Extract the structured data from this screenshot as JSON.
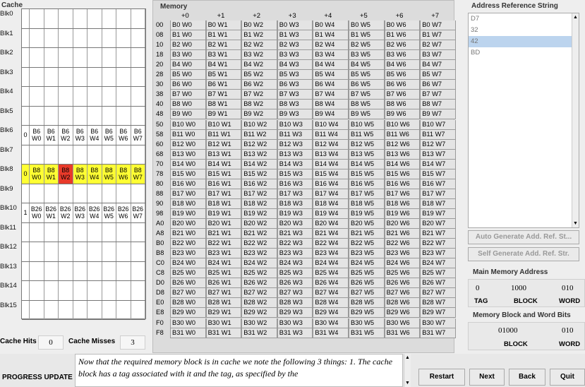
{
  "cache": {
    "title": "Cache",
    "hits_label": "Cache Hits",
    "hits": "0",
    "misses_label": "Cache Misses",
    "misses": "3",
    "blocks": [
      {
        "label": "Blk0"
      },
      {
        "label": "Blk1"
      },
      {
        "label": "Blk2"
      },
      {
        "label": "Blk3"
      },
      {
        "label": "Blk4"
      },
      {
        "label": "Blk5"
      },
      {
        "label": "Blk6",
        "tag": "0",
        "cells": [
          "B6 W0",
          "B6 W1",
          "B6 W2",
          "B6 W3",
          "B6 W4",
          "B6 W5",
          "B6 W6",
          "B6 W7"
        ]
      },
      {
        "label": "Blk7"
      },
      {
        "label": "Blk8",
        "tag": "0",
        "cells": [
          "B8 W0",
          "B8 W1",
          "B8 W2",
          "B8 W3",
          "B8 W4",
          "B8 W5",
          "B8 W6",
          "B8 W7"
        ],
        "highlight": true,
        "selected_word": 2
      },
      {
        "label": "Blk9"
      },
      {
        "label": "Blk10",
        "tag": "1",
        "cells": [
          "B26 W0",
          "B26 W1",
          "B26 W2",
          "B26 W3",
          "B26 W4",
          "B26 W5",
          "B26 W6",
          "B26 W7"
        ]
      },
      {
        "label": "Blk11"
      },
      {
        "label": "Blk12"
      },
      {
        "label": "Blk13"
      },
      {
        "label": "Blk14"
      },
      {
        "label": "Blk15"
      }
    ],
    "colors": {
      "highlight": "#ffff33",
      "selected": "#e83a2a"
    }
  },
  "memory": {
    "title": "Memory",
    "offsets": [
      "+0",
      "+1",
      "+2",
      "+3",
      "+4",
      "+5",
      "+6",
      "+7"
    ],
    "addresses": [
      "00",
      "08",
      "10",
      "18",
      "20",
      "28",
      "30",
      "38",
      "40",
      "48",
      "50",
      "58",
      "60",
      "68",
      "70",
      "78",
      "80",
      "88",
      "90",
      "98",
      "A0",
      "A8",
      "B0",
      "B8",
      "C0",
      "C8",
      "D0",
      "D8",
      "E0",
      "E8",
      "F0",
      "F8"
    ],
    "block_start": 0,
    "block_count": 32,
    "cell_prefix": "B",
    "word_prefix": "W"
  },
  "ars": {
    "title": "Address Reference String",
    "items": [
      "D7",
      "32",
      "42",
      "BD"
    ],
    "selected_index": 2,
    "auto_btn": "Auto Generate Add. Ref. St...",
    "self_btn": "Self Generate Add. Ref. Str."
  },
  "mma": {
    "title": "Main Memory Address",
    "tag": "0",
    "block": "1000",
    "word": "010",
    "tag_label": "TAG",
    "block_label": "BLOCK",
    "word_label": "WORD"
  },
  "mbw": {
    "title": "Memory Block and Word Bits",
    "block": "01000",
    "word": "010",
    "block_label": "BLOCK",
    "word_label": "WORD"
  },
  "progress": {
    "label": "PROGRESS UPDATE",
    "text": "Now that the required memory block is in cache we note the following 3 things: 1. The cache block has a tag associated with it and the tag, as specified by the"
  },
  "buttons": {
    "restart": "Restart",
    "next": "Next",
    "back": "Back",
    "quit": "Quit"
  }
}
